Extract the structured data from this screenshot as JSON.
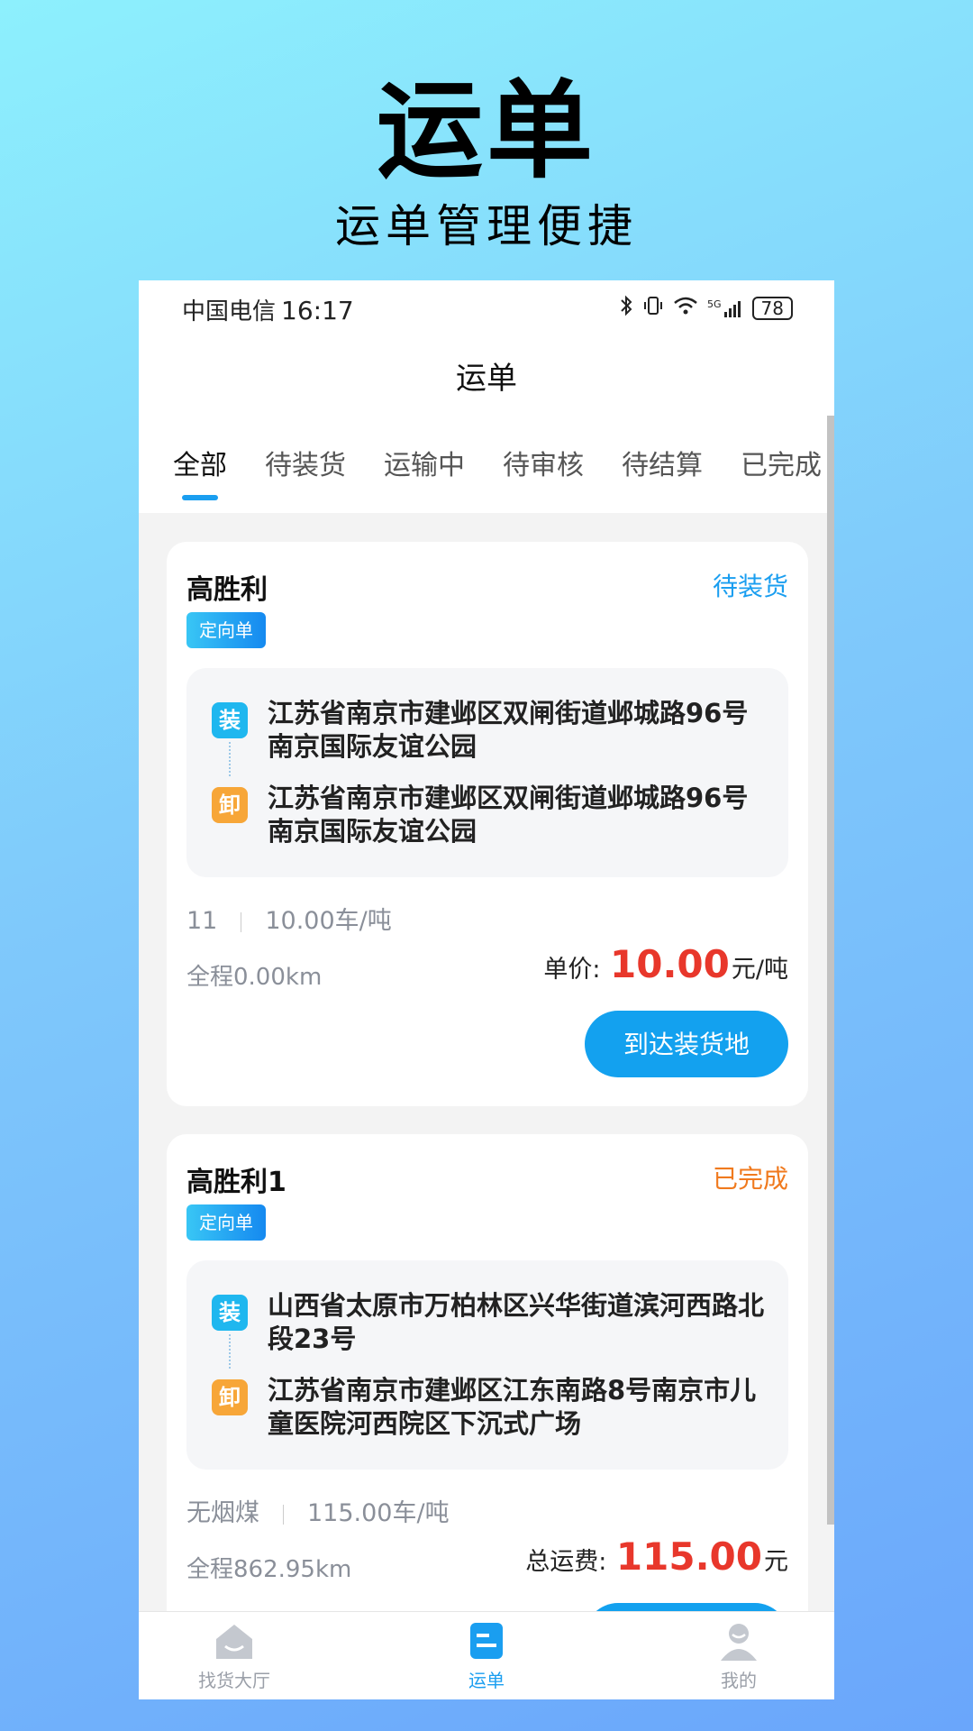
{
  "hero": {
    "title": "运单",
    "subtitle": "运单管理便捷"
  },
  "status_bar": {
    "carrier": "中国电信",
    "time": "16:17",
    "battery": "78",
    "network": "5G"
  },
  "nav": {
    "title": "运单"
  },
  "tabs": [
    {
      "label": "全部",
      "active": true
    },
    {
      "label": "待装货",
      "active": false
    },
    {
      "label": "运输中",
      "active": false
    },
    {
      "label": "待审核",
      "active": false
    },
    {
      "label": "待结算",
      "active": false
    },
    {
      "label": "已完成",
      "active": false
    }
  ],
  "orders": [
    {
      "name": "高胜利",
      "status": "待装货",
      "status_color": "#1a9ef0",
      "tag": "定向单",
      "load_icon": "装",
      "unload_icon": "卸",
      "load_address": "江苏省南京市建邺区双闸街道邺城路96号南京国际友谊公园",
      "unload_address": "江苏省南京市建邺区双闸街道邺城路96号南京国际友谊公园",
      "cargo": "11",
      "rate": "10.00车/吨",
      "distance": "全程0.00km",
      "price_label": "单价:",
      "price_value": "10.00",
      "price_unit": "元/吨",
      "action": "到达装货地"
    },
    {
      "name": "高胜利1",
      "status": "已完成",
      "status_color": "#f07a1e",
      "tag": "定向单",
      "load_icon": "装",
      "unload_icon": "卸",
      "load_address": "山西省太原市万柏林区兴华街道滨河西路北段23号",
      "unload_address": "江苏省南京市建邺区江东南路8号南京市儿童医院河西院区下沉式广场",
      "cargo": "无烟煤",
      "rate": "115.00车/吨",
      "distance": "全程862.95km",
      "price_label": "总运费:",
      "price_value": "115.00",
      "price_unit": "元"
    }
  ],
  "bottom_nav": [
    {
      "label": "找货大厅",
      "icon": "home-icon",
      "active": false
    },
    {
      "label": "运单",
      "icon": "waybill-icon",
      "active": true
    },
    {
      "label": "我的",
      "icon": "user-icon",
      "active": false
    }
  ],
  "colors": {
    "accent": "#1a9ef0",
    "price": "#e8372b",
    "completed": "#f07a1e"
  }
}
